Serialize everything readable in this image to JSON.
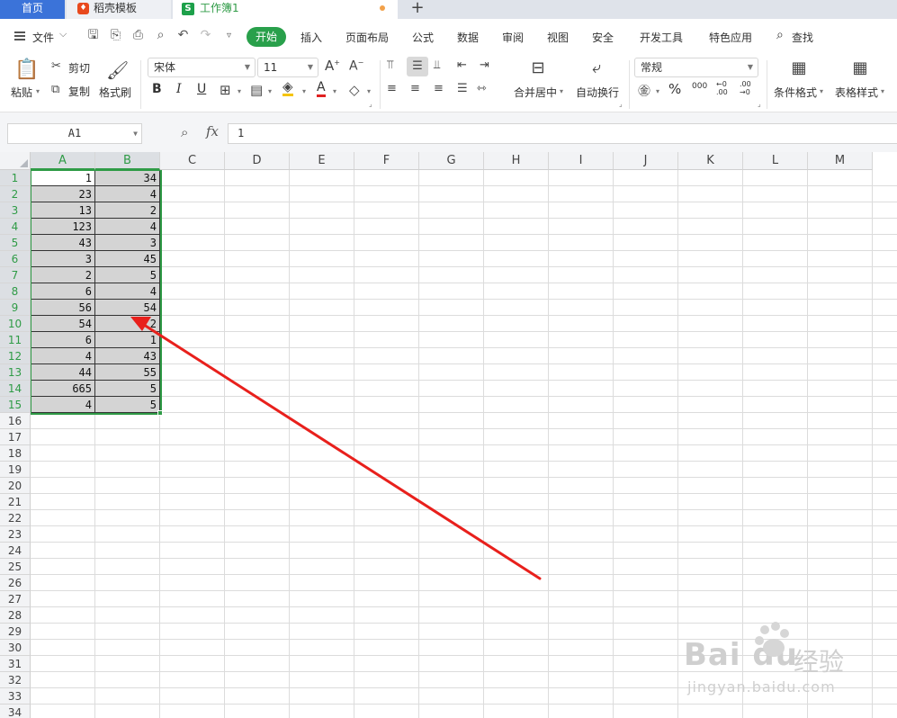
{
  "tabs": {
    "home": "首页",
    "daoke_template": "稻壳模板",
    "workbook": "工作簿1",
    "workbook_icon_letter": "S"
  },
  "menubar": {
    "file": "文件",
    "start": "开始",
    "insert": "插入",
    "page_layout": "页面布局",
    "formulas": "公式",
    "data": "数据",
    "review": "审阅",
    "view": "视图",
    "security": "安全",
    "developer_tools": "开发工具",
    "special_apps": "特色应用",
    "find": "查找"
  },
  "ribbon": {
    "paste": "粘贴",
    "cut": "剪切",
    "copy": "复制",
    "format_painter": "格式刷",
    "font_name": "宋体",
    "font_size": "11",
    "bold": "B",
    "italic": "I",
    "underline": "U",
    "font_color_letter": "A",
    "merge_center": "合并居中",
    "wrap_text": "自动换行",
    "number_format": "常规",
    "percent": "%",
    "thousands": "000",
    "increase_decimal": "←0 .00",
    "decrease_decimal": ".00 →0",
    "conditional_format": "条件格式",
    "table_style": "表格样式"
  },
  "formula_bar": {
    "name_box": "A1",
    "fx": "fx",
    "value": "1"
  },
  "grid": {
    "columns": [
      "A",
      "B",
      "C",
      "D",
      "E",
      "F",
      "G",
      "H",
      "I",
      "J",
      "K",
      "L",
      "M"
    ],
    "row_count": 34,
    "cells": [
      [
        "1",
        "34"
      ],
      [
        "23",
        "4"
      ],
      [
        "13",
        "2"
      ],
      [
        "123",
        "4"
      ],
      [
        "43",
        "3"
      ],
      [
        "3",
        "45"
      ],
      [
        "2",
        "5"
      ],
      [
        "6",
        "4"
      ],
      [
        "56",
        "54"
      ],
      [
        "54",
        "2"
      ],
      [
        "6",
        "1"
      ],
      [
        "4",
        "43"
      ],
      [
        "44",
        "55"
      ],
      [
        "665",
        "5"
      ],
      [
        "4",
        "5"
      ]
    ],
    "selected_columns": [
      "A",
      "B"
    ],
    "selected_rows": 15,
    "selection_color": "#2f9b46"
  },
  "annotation": {
    "arrow_color": "#e8201c"
  },
  "watermark": {
    "logo": "Bai du",
    "brand_cn": "经验",
    "url": "jingyan.baidu.com"
  }
}
